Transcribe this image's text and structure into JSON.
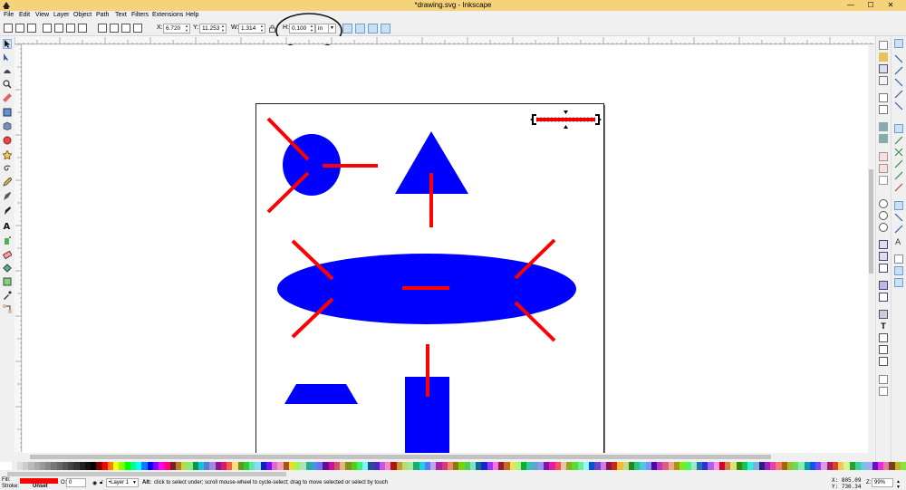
{
  "window": {
    "title": "*drawing.svg - Inkscape",
    "minimize": "—",
    "maximize": "☐",
    "close": "✕"
  },
  "menu": [
    "File",
    "Edit",
    "View",
    "Layer",
    "Object",
    "Path",
    "Text",
    "Filters",
    "Extensions",
    "Help"
  ],
  "toolbar": {
    "x_label": "X:",
    "x_value": "6.720",
    "y_label": "Y:",
    "y_value": "11.253",
    "w_label": "W:",
    "w_value": "1.314",
    "h_label": "H:",
    "h_value": "0.100",
    "unit": "in"
  },
  "status": {
    "fill_label": "Fill:",
    "stroke_label": "Stroke:",
    "fill_color": "#ff0000",
    "stroke_value": "Unset",
    "opacity_label": "O:",
    "opacity_value": "0",
    "layer_name": "•Layer 1",
    "message_bold": "Alt:",
    "message": "click to select under; scroll mouse-wheel to cycle-select; drag to move selected or select by touch",
    "x_coord": "X: 805.09",
    "y_coord": "Y: 730.34",
    "zoom_label": "Z:",
    "zoom_value": "99%"
  },
  "colors": {
    "shape_blue": "#0000ff",
    "line_red": "#ff0000",
    "titlebar": "#f6d37a"
  }
}
